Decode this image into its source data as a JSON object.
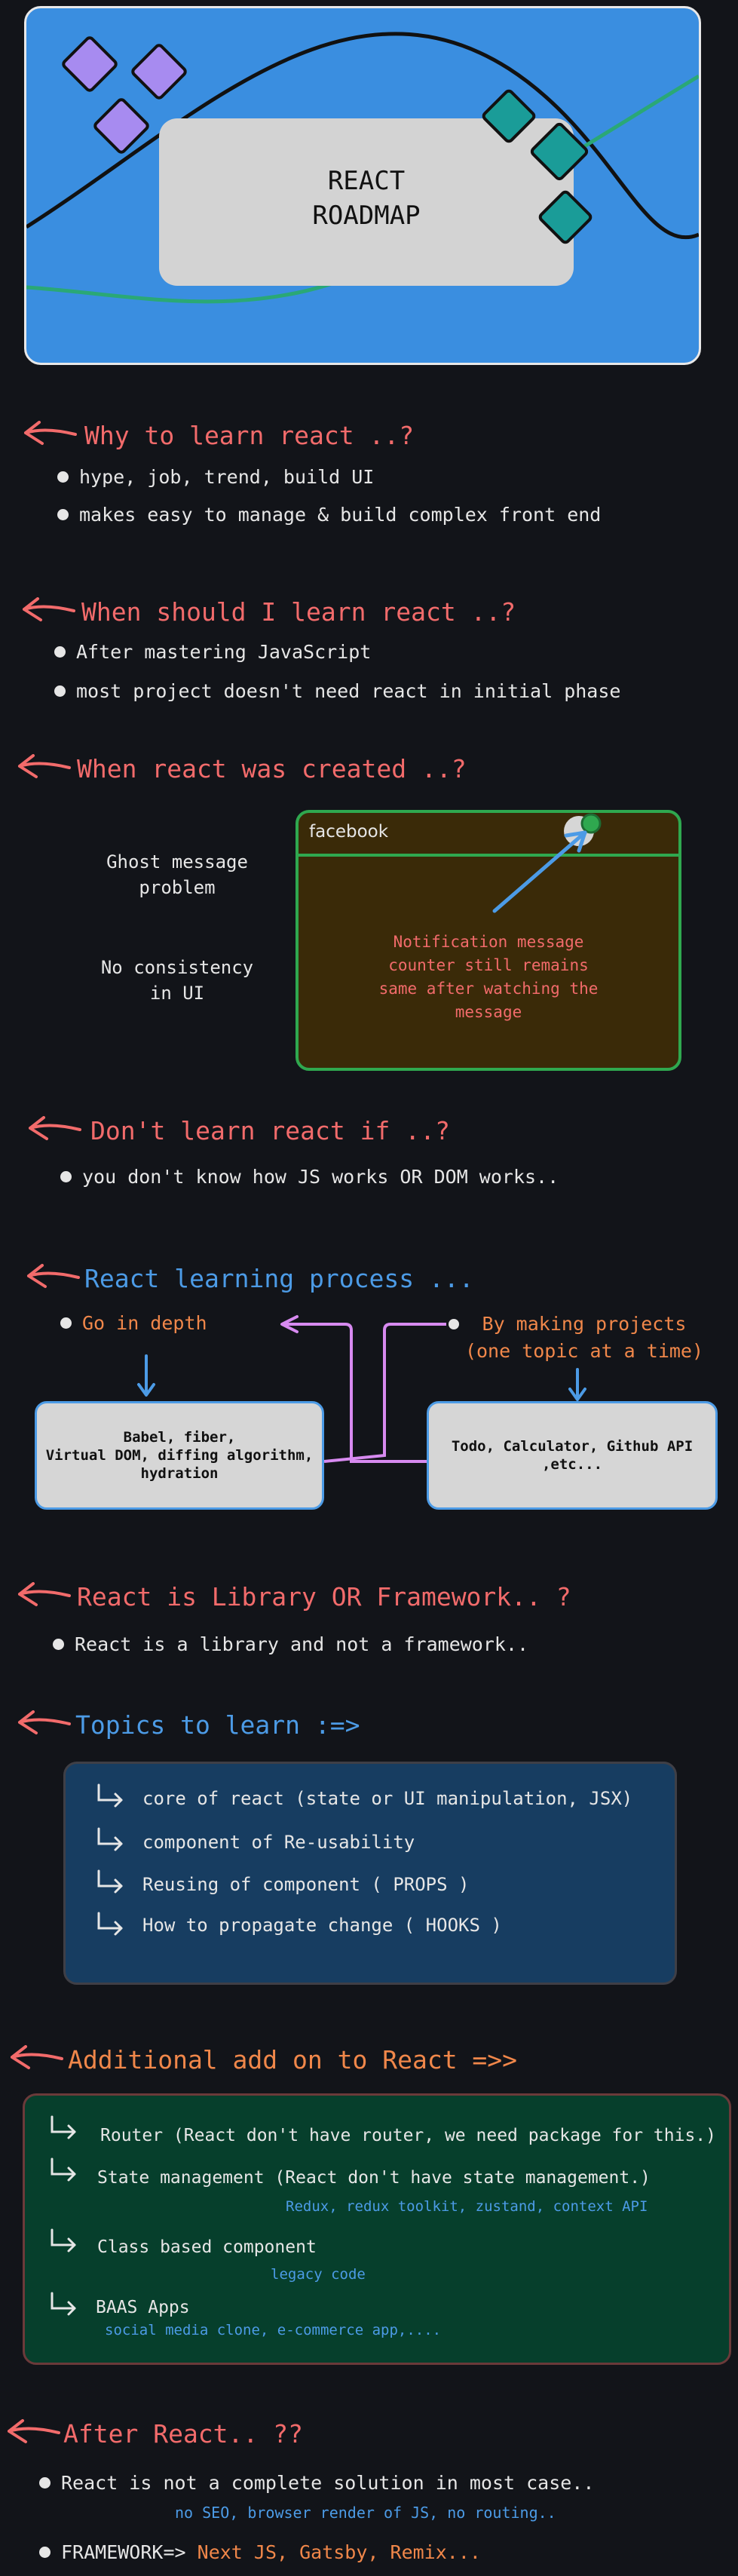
{
  "banner": {
    "title_line1": "REACT",
    "title_line2": "ROADMAP"
  },
  "why": {
    "heading": "Why to learn react ..?",
    "items": [
      "hype, job, trend, build UI",
      "makes easy to manage & build complex front end"
    ]
  },
  "when": {
    "heading": "When should I learn react ..?",
    "items": [
      "After mastering JavaScript",
      "most project doesn't need react in initial phase"
    ]
  },
  "created": {
    "heading": "When react was created ..?",
    "problem1_line1": "Ghost message",
    "problem1_line2": "problem",
    "problem2_line1": "No consistency",
    "problem2_line2": "in UI",
    "fb_label": "facebook",
    "note_line1": "Notification message",
    "note_line2": "counter still remains",
    "note_line3": "same after watching the",
    "note_line4": "message"
  },
  "dont": {
    "heading": "Don't learn react if ..?",
    "items": [
      "you don't know how JS works OR DOM works.."
    ]
  },
  "process": {
    "heading": "React learning process ...",
    "left_label": "Go in depth",
    "right_line1": "By making projects",
    "right_line2": "(one topic at a time)",
    "left_box_line1": "Babel, fiber,",
    "left_box_line2": "Virtual DOM, diffing algorithm,",
    "left_box_line3": "hydration",
    "right_box_line1": "Todo, Calculator, Github API",
    "right_box_line2": ",etc..."
  },
  "library": {
    "heading": "React is Library OR Framework.. ?",
    "items": [
      "React is a library and not a framework.."
    ]
  },
  "topics": {
    "heading": "Topics to learn :=>",
    "items": [
      "core of react (state or UI manipulation, JSX)",
      "component of Re-usability",
      "Reusing of component ( PROPS )",
      "How to propagate change ( HOOKS )"
    ]
  },
  "addons": {
    "heading": "Additional add on to React =>>",
    "items": [
      {
        "label": "Router (React don't have router, we need package for this.)",
        "note": ""
      },
      {
        "label": "State management (React don't have state management.)",
        "note": "Redux, redux toolkit, zustand, context API"
      },
      {
        "label": "Class based component",
        "note": "legacy code"
      },
      {
        "label": "BAAS Apps",
        "note": "social media clone, e-commerce app,...."
      }
    ]
  },
  "after": {
    "heading": "After React.. ??",
    "item1": "React is not a complete solution in most case..",
    "item1_note": "no SEO, browser render of JS, no routing..",
    "item2_prefix": "FRAMEWORK=>",
    "item2_value": "Next JS, Gatsby, Remix..."
  },
  "colors": {
    "red": "#f26b6b",
    "blue": "#4c9be6",
    "orange": "#f0874a",
    "green": "#2fa84f",
    "teal": "#1a9c98",
    "lilac": "#a78bf0"
  }
}
